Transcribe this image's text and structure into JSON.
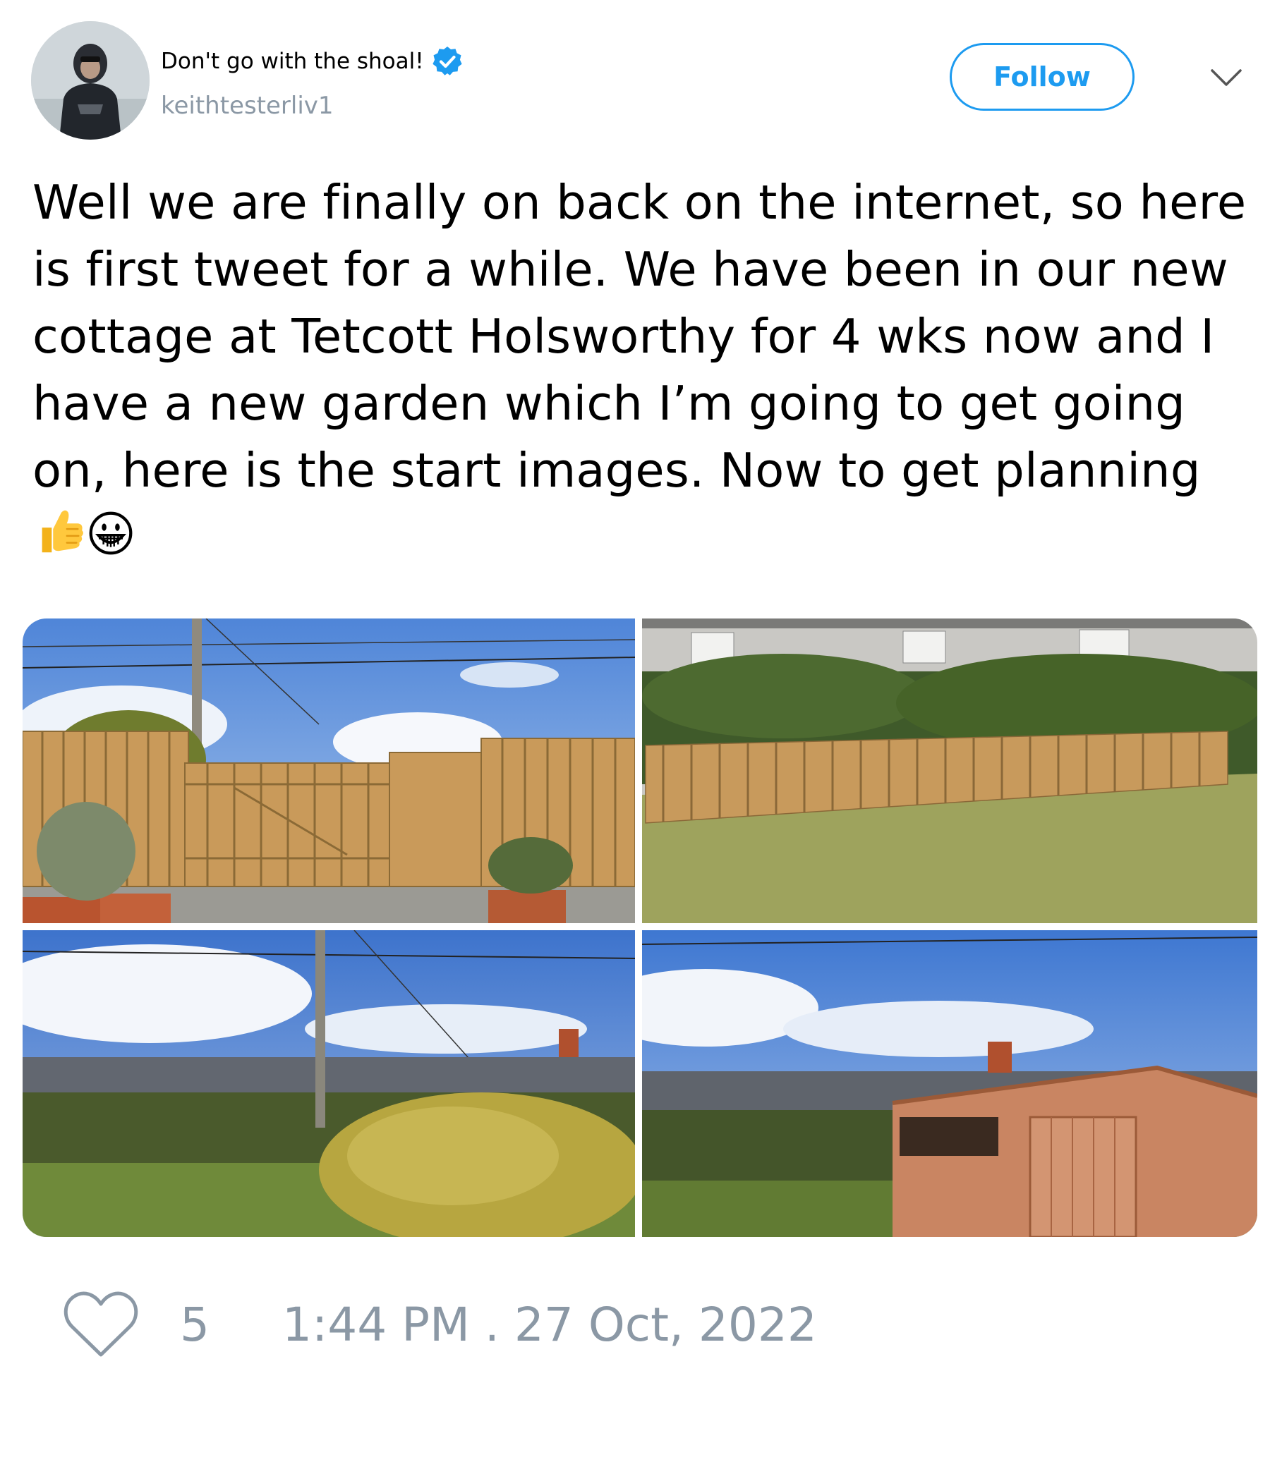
{
  "user": {
    "display_name": "Don't go with the shoal!",
    "handle": "keithtesterliv1",
    "verified": true
  },
  "header": {
    "follow_label": "Follow",
    "menu_icon": "chevron-down-icon"
  },
  "tweet": {
    "text": "Well we are finally on back on the internet, so here is first tweet for a while. We have been in our new cottage at Tetcott Holsworthy for 4 wks now and I have a new garden which I’m going to get going on, here is the start images. Now to get planning",
    "emojis": [
      "thumbs-up-icon",
      "grinning-face-icon"
    ],
    "photos": [
      {
        "label": "wooden picket gate photo"
      },
      {
        "label": "picket fence and lawn photo"
      },
      {
        "label": "hedge and rooftops photo"
      },
      {
        "label": "garden shed photo"
      }
    ]
  },
  "footer": {
    "like_icon": "heart-icon",
    "like_count": "5",
    "timestamp": "1:44 PM . 27 Oct, 2022"
  },
  "colors": {
    "accent": "#1d9bf0",
    "muted": "#8b98a5"
  }
}
